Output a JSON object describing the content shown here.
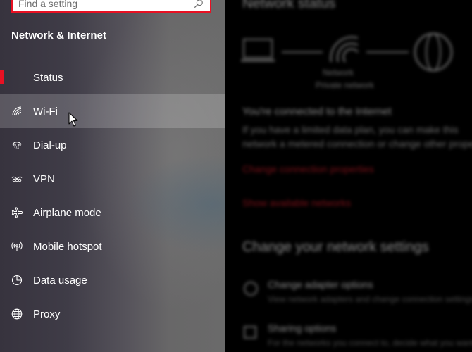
{
  "search": {
    "placeholder": "Find a setting",
    "icon": "search-icon"
  },
  "section_title": "Network & Internet",
  "nav": {
    "items": [
      {
        "label": "Status",
        "icon": "status-icon",
        "selected": true
      },
      {
        "label": "Wi-Fi",
        "icon": "wifi-icon",
        "hover": true
      },
      {
        "label": "Dial-up",
        "icon": "dialup-icon"
      },
      {
        "label": "VPN",
        "icon": "vpn-icon"
      },
      {
        "label": "Airplane mode",
        "icon": "airplane-icon"
      },
      {
        "label": "Mobile hotspot",
        "icon": "hotspot-icon"
      },
      {
        "label": "Data usage",
        "icon": "data-usage-icon"
      },
      {
        "label": "Proxy",
        "icon": "globe-icon"
      }
    ]
  },
  "content": {
    "title": "Network status",
    "network_name": "Network",
    "network_type": "Private network",
    "connected_text": "You're connected to the Internet",
    "metered_line1": "If you have a limited data plan, you can make this",
    "metered_line2": "network a metered connection or change other properties.",
    "link_change_props": "Change connection properties",
    "link_show_networks": "Show available networks",
    "section_change": "Change your network settings",
    "adapter_title": "Change adapter options",
    "adapter_desc": "View network adapters and change connection settings.",
    "sharing_title": "Sharing options",
    "sharing_desc": "For the networks you connect to, decide what you want to share."
  },
  "colors": {
    "accent": "#e81123",
    "sidebar_dark": "#37333e",
    "content_bg": "#000000",
    "link": "#7a1018"
  }
}
